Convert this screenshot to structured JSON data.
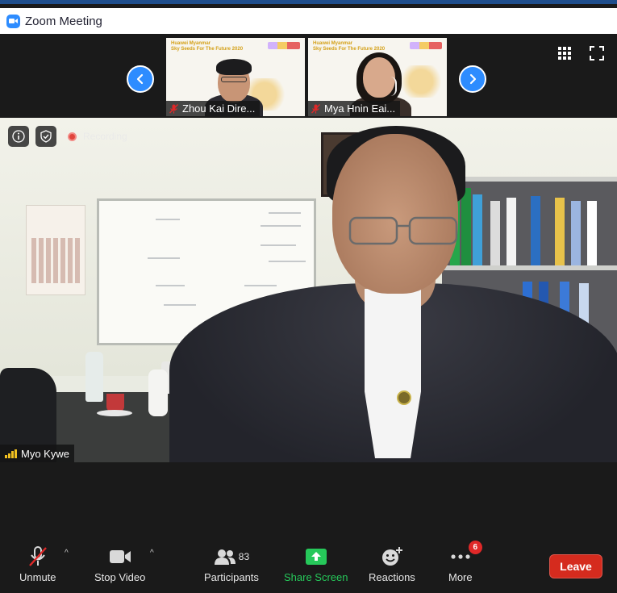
{
  "window": {
    "title": "Zoom Meeting",
    "app_icon": "zoom-camera-icon",
    "accent": "#2d8cff",
    "frame_color": "#1f4e8c"
  },
  "thumbnails": [
    {
      "name": "Zhou Kai Dire...",
      "mic": "muted",
      "slide_title": "Huawei Myanmar\nSky Seeds For The Future 2020"
    },
    {
      "name": "Mya Hnin Eai...",
      "mic": "muted",
      "slide_title": "Huawei Myanmar\nSky Seeds For The Future 2020"
    }
  ],
  "top_controls": {
    "gallery_icon": "grid-view-icon",
    "fullscreen_icon": "fullscreen-icon"
  },
  "main_video": {
    "speaker": "Myo Kywe",
    "recording_label": "Recording",
    "info_icon": "info-icon",
    "security_icon": "shield-check-icon",
    "signal_color": "#f0c020"
  },
  "toolbar": {
    "unmute": {
      "label": "Unmute",
      "icon": "mic-muted-icon"
    },
    "video": {
      "label": "Stop Video",
      "icon": "video-camera-icon"
    },
    "participants": {
      "label": "Participants",
      "icon": "participants-icon",
      "count": "83"
    },
    "share": {
      "label": "Share Screen",
      "icon": "share-screen-icon",
      "color": "#26c85a"
    },
    "reactions": {
      "label": "Reactions",
      "icon": "reaction-smile-icon"
    },
    "more": {
      "label": "More",
      "icon": "more-dots-icon",
      "badge": "6"
    },
    "leave": {
      "label": "Leave",
      "color": "#d52b1e"
    }
  }
}
